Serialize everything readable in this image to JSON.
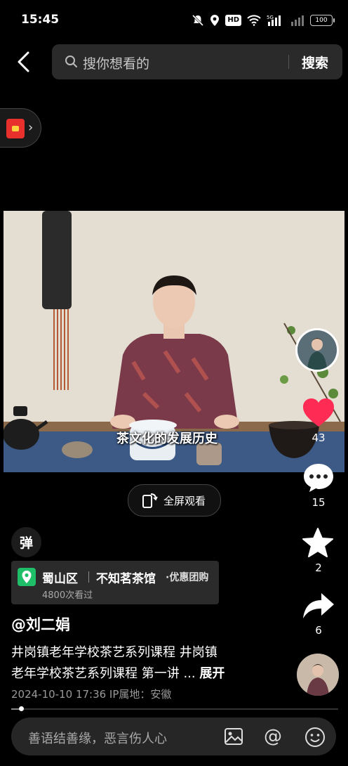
{
  "status_bar": {
    "time": "15:45",
    "hd": "HD",
    "network": "5G",
    "battery": "100"
  },
  "search": {
    "placeholder": "搜你想看的",
    "button": "搜索"
  },
  "video": {
    "subtitle": "茶文化的发展历史",
    "fullscreen_label": "全屏观看"
  },
  "actions": {
    "likes": "43",
    "comments": "15",
    "favorites": "2",
    "shares": "6"
  },
  "danmaku": {
    "label": "弹"
  },
  "poi": {
    "district": "蜀山区",
    "shop": "不知茗茶馆",
    "tag": "·优惠团购",
    "views": "4800次看过"
  },
  "post": {
    "author": "@刘二娟",
    "desc_line1": "井岗镇老年学校茶艺系列课程 井岗镇",
    "desc_line2": "老年学校茶艺系列课程 第一讲 ... ",
    "expand": "展开",
    "meta": "2024-10-10 17:36  IP属地：安徽"
  },
  "progress": {
    "played_fraction": 0.03
  },
  "comment_bar": {
    "placeholder": "善语结善缘，恶言伤人心"
  },
  "colors": {
    "like": "#fe2c55",
    "poi_green": "#1fbf6a",
    "background": "#000000"
  }
}
